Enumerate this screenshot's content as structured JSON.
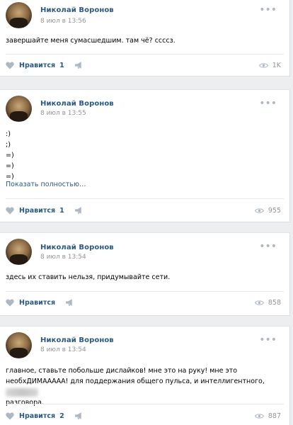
{
  "posts": [
    {
      "author": "Николай Воронов",
      "date": "8 июл в 13:56",
      "lines": [
        "завершайте меня сумасшедшим. там чё? ссссз."
      ],
      "more": "",
      "like_label": "Нравится",
      "likes": "1",
      "views": "1K"
    },
    {
      "author": "Николай Воронов",
      "date": "8 июл в 13:55",
      "lines": [
        ":)",
        ";)",
        "=)",
        "=)",
        "=)"
      ],
      "more": "Показать полностью…",
      "like_label": "Нравится",
      "likes": "1",
      "views": "955"
    },
    {
      "author": "Николай Воронов",
      "date": "8 июл в 13:54",
      "lines": [
        "здесь их ставить нельзя, придумывайте сети."
      ],
      "more": "",
      "like_label": "Нравится",
      "likes": "",
      "views": "858"
    },
    {
      "author": "Николай Воронов",
      "date": "8 июл в 13:54",
      "lines": [
        "главное, ставьте побольше дислайков! мне это на руку! мне это",
        "необхДИМААААА! для поддержания общего пульса, и интеллигентного,",
        "разговора."
      ],
      "more": "",
      "like_label": "Нравится",
      "likes": "2",
      "views": "887"
    }
  ],
  "icons": {
    "heart": "heart-icon",
    "share": "megaphone-icon",
    "eye": "eye-icon",
    "menu": "more-icon"
  },
  "colors": {
    "link": "#2a5885",
    "muted": "#939393",
    "icon": "#aeb7c2",
    "background": "#edeef0"
  }
}
